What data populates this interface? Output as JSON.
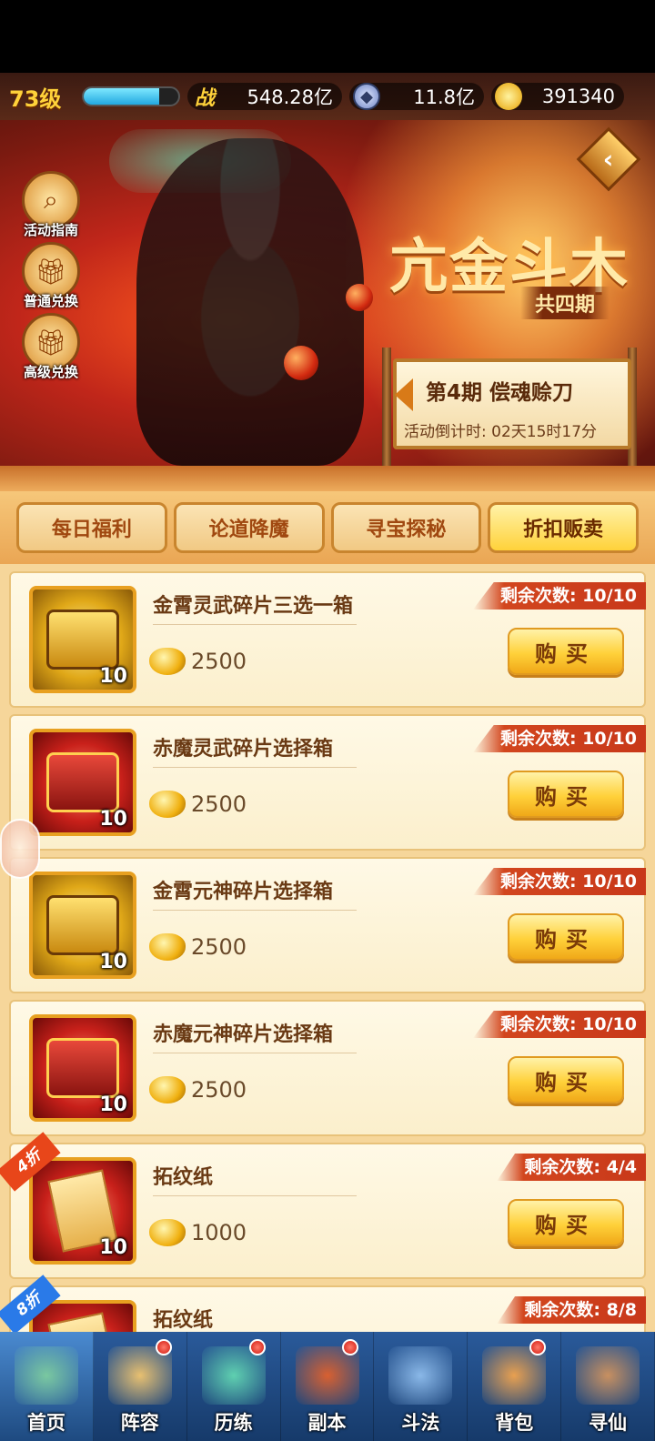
{
  "header": {
    "level": "73级",
    "xp_fraction": 0.8,
    "power_icon_label": "战",
    "power": "548.28亿",
    "coins": "11.8亿",
    "ingots": "391340"
  },
  "banner": {
    "title": "亢金斗木",
    "subtitle": "共四期",
    "side_buttons": [
      {
        "label": "活动指南",
        "icon": "magnifier-icon"
      },
      {
        "label": "普通兑换",
        "icon": "gift-box-icon"
      },
      {
        "label": "高级兑换",
        "icon": "gift-box-icon"
      }
    ],
    "period_name": "第4期  偿魂赊刀",
    "countdown": "活动倒计时: 02天15时17分"
  },
  "tabs": [
    {
      "label": "每日福利",
      "active": false
    },
    {
      "label": "论道降魔",
      "active": false
    },
    {
      "label": "寻宝探秘",
      "active": false
    },
    {
      "label": "折扣贩卖",
      "active": true
    }
  ],
  "shop_items": [
    {
      "name": "金霄灵武碎片三选一箱",
      "price": "2500",
      "qty": "10",
      "remaining": "剩余次数: 10/10",
      "buy_label": "购买",
      "style": "gold",
      "discount": ""
    },
    {
      "name": "赤魔灵武碎片选择箱",
      "price": "2500",
      "qty": "10",
      "remaining": "剩余次数: 10/10",
      "buy_label": "购买",
      "style": "red",
      "discount": ""
    },
    {
      "name": "金霄元神碎片选择箱",
      "price": "2500",
      "qty": "10",
      "remaining": "剩余次数: 10/10",
      "buy_label": "购买",
      "style": "gold",
      "discount": ""
    },
    {
      "name": "赤魔元神碎片选择箱",
      "price": "2500",
      "qty": "10",
      "remaining": "剩余次数: 10/10",
      "buy_label": "购买",
      "style": "red",
      "discount": ""
    },
    {
      "name": "拓纹纸",
      "price": "1000",
      "qty": "10",
      "remaining": "剩余次数: 4/4",
      "buy_label": "购买",
      "style": "red",
      "discount": "4折"
    },
    {
      "name": "拓纹纸",
      "price": "",
      "qty": "",
      "remaining": "剩余次数: 8/8",
      "buy_label": "",
      "style": "red",
      "discount": "8折"
    }
  ],
  "bottom_nav": [
    {
      "label": "首页",
      "badge": false,
      "active": true
    },
    {
      "label": "阵容",
      "badge": true,
      "active": false
    },
    {
      "label": "历练",
      "badge": true,
      "active": false
    },
    {
      "label": "副本",
      "badge": true,
      "active": false
    },
    {
      "label": "斗法",
      "badge": false,
      "active": false
    },
    {
      "label": "背包",
      "badge": true,
      "active": false
    },
    {
      "label": "寻仙",
      "badge": false,
      "active": false
    }
  ]
}
